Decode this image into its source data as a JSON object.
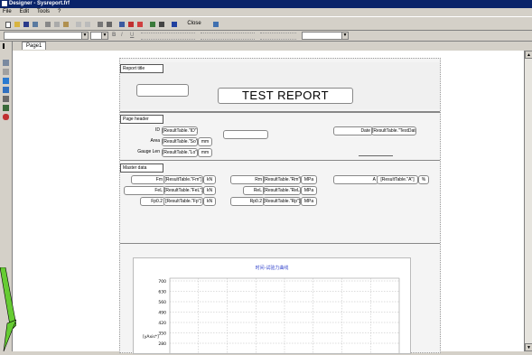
{
  "window": {
    "title": "Designer - Sysreport.frf"
  },
  "menu": {
    "file": "File",
    "edit": "Edit",
    "tools": "Tools",
    "help": "?"
  },
  "toolbar": {
    "close_label": "Close"
  },
  "tabs": {
    "page1": "Page1"
  },
  "report": {
    "title_band": "Report title",
    "title_text": "TEST REPORT",
    "page_header_band": "Page header",
    "master_band": "Master data"
  },
  "header_fields": {
    "id_label": "ID",
    "id_value": "[ResultTable.\"ID\"]",
    "area_label": "Area",
    "area_value": "[ResultTable.\"So\"]",
    "area_unit": "mm",
    "gauge_label": "Gauge Len",
    "gauge_value": "[ResultTable.\"Lo\"]",
    "gauge_unit": "mm",
    "date_label": "Date",
    "date_value": "[ResultTable.\"TestDate\"]"
  },
  "master_fields": {
    "fm_label": "Fm",
    "fm_value": "[ResultTable.\"Fm\"]",
    "fm_unit": "kN",
    "fel_label": "FeL",
    "fel_value": "[ResultTable.\"FeL\"]",
    "fel_unit": "kN",
    "fp_label": "Fp0.2",
    "fp_value": "[ResultTable.\"Fp\"]",
    "fp_unit": "kN",
    "rm_label": "Rm",
    "rm_value": "[ResultTable.\"Rm\"]",
    "rm_unit": "MPa",
    "rel_label": "ReL",
    "rel_value": "[ResultTable.\"ReL\"]",
    "rel_unit": "MPa",
    "rp_label": "Rp0.2",
    "rp_value": "[ResultTable.\"Rp\"]",
    "rp_unit": "MPa",
    "a_label": "A",
    "a_value": "[ResultTable.\"A\"]",
    "a_unit": "%"
  },
  "chart_data": {
    "type": "line",
    "title": "时间-试验力曲线",
    "ylabel": "[yAxis*]",
    "y_ticks": [
      "700",
      "630",
      "560",
      "490",
      "420",
      "350",
      "280"
    ],
    "ylim": [
      280,
      700
    ],
    "series": [],
    "grid": true
  },
  "colors": {
    "titlebar": "#0a246a",
    "chart_title": "#3344cc",
    "arrow": "#66cc33"
  }
}
